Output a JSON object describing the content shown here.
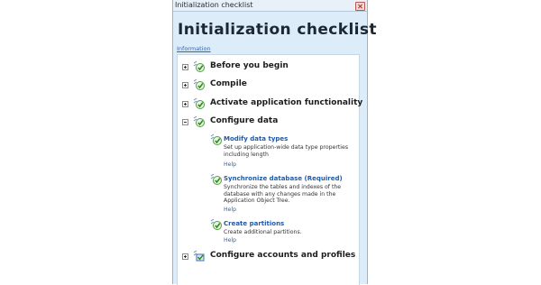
{
  "window": {
    "title": "Initialization checklist",
    "heading": "Initialization checklist",
    "info_link": "Information"
  },
  "sections": [
    {
      "label": "Before you begin",
      "expanded": false
    },
    {
      "label": "Compile",
      "expanded": false
    },
    {
      "label": "Activate application functionality",
      "expanded": false
    },
    {
      "label": "Configure data",
      "expanded": true
    },
    {
      "label": "Configure accounts and profiles",
      "expanded": false
    }
  ],
  "tasks": [
    {
      "title": "Modify data types",
      "desc1": "Set up application-wide data type properties",
      "desc2": "including length",
      "desc3": "",
      "help": "Help"
    },
    {
      "title": "Synchronize database (Required)",
      "desc1": "Synchronize the tables and indexes of the",
      "desc2": "database with any changes made in the",
      "desc3": "Application Object Tree.",
      "help": "Help"
    },
    {
      "title": "Create partitions",
      "desc1": "Create additional partitions.",
      "desc2": "",
      "desc3": "",
      "help": "Help"
    }
  ],
  "colors": {
    "accent": "#1f5aa8",
    "window_bg": "#dcecf8",
    "check": "#3a9a2a"
  },
  "icons": {
    "section": "checklist-icon",
    "task": "task-check-icon",
    "expand": "expand-icon",
    "collapse": "collapse-icon"
  }
}
